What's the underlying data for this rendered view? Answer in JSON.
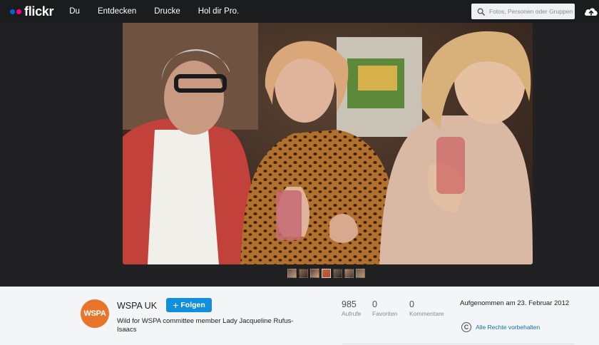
{
  "brand": {
    "logo_text": "flickr",
    "dot_blue": "#0063dc",
    "dot_pink": "#ff0084"
  },
  "nav": {
    "items": [
      "Du",
      "Entdecken",
      "Drucke",
      "Hol dir Pro."
    ]
  },
  "search": {
    "placeholder": "Fotos, Personen oder Gruppen",
    "icon": "search-icon"
  },
  "upload": {
    "icon": "cloud-upload-icon"
  },
  "filmstrip": {
    "count": 7,
    "active_index": 3
  },
  "owner": {
    "name": "WSPA UK",
    "avatar_text": "WSPA",
    "avatar_color": "#e8752a",
    "follow_label": "Folgen"
  },
  "photo": {
    "title": "Wild for WSPA committee member Lady Jacqueline Rufus-Isaacs"
  },
  "stats": {
    "views": {
      "value": "985",
      "label": "Aufrufe"
    },
    "faves": {
      "value": "0",
      "label": "Favoriten"
    },
    "comments": {
      "value": "0",
      "label": "Kommentare"
    }
  },
  "meta": {
    "taken": "Aufgenommen am 23. Februar 2012",
    "license": "Alle Rechte vorbehalten",
    "license_icon": "copyright-icon"
  },
  "colors": {
    "accent": "#128fdc",
    "link": "#0f6fb8",
    "topbar": "#1b1c1e",
    "stage": "#212124"
  }
}
